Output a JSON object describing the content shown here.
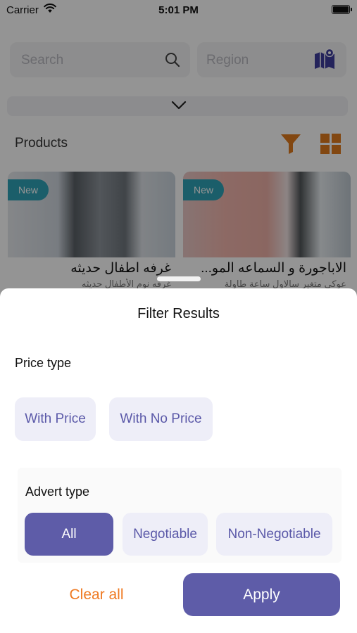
{
  "status_bar": {
    "carrier": "Carrier",
    "time": "5:01 PM"
  },
  "header": {
    "search_placeholder": "Search",
    "region_placeholder": "Region"
  },
  "products": {
    "title": "Products",
    "cards": [
      {
        "badge": "New",
        "title": "غرفه اطفال حديثه",
        "subtitle": "غرفه نوم الأطفال حديثه"
      },
      {
        "badge": "New",
        "title": "الاباجورة و السماعه المو...",
        "subtitle": "عوكي متغير سالاول ساعة طاولة"
      }
    ]
  },
  "filter_sheet": {
    "title": "Filter Results",
    "price_type": {
      "label": "Price type",
      "options": [
        "With Price",
        "With No Price"
      ]
    },
    "advert_type": {
      "label": "Advert type",
      "options": [
        "All",
        "Negotiable",
        "Non-Negotiable"
      ],
      "selected": "All"
    },
    "clear_label": "Clear all",
    "apply_label": "Apply"
  },
  "colors": {
    "accent": "#5e5ca8",
    "chip_bg": "#eeeef8",
    "clear_text": "#ef7a22",
    "badge": "#2fa3b7",
    "icon_orange": "#e07a1e"
  },
  "icons": [
    "wifi-icon",
    "battery-icon",
    "search-icon",
    "map-icon",
    "chevron-down-icon",
    "filter-icon",
    "grid-icon"
  ]
}
